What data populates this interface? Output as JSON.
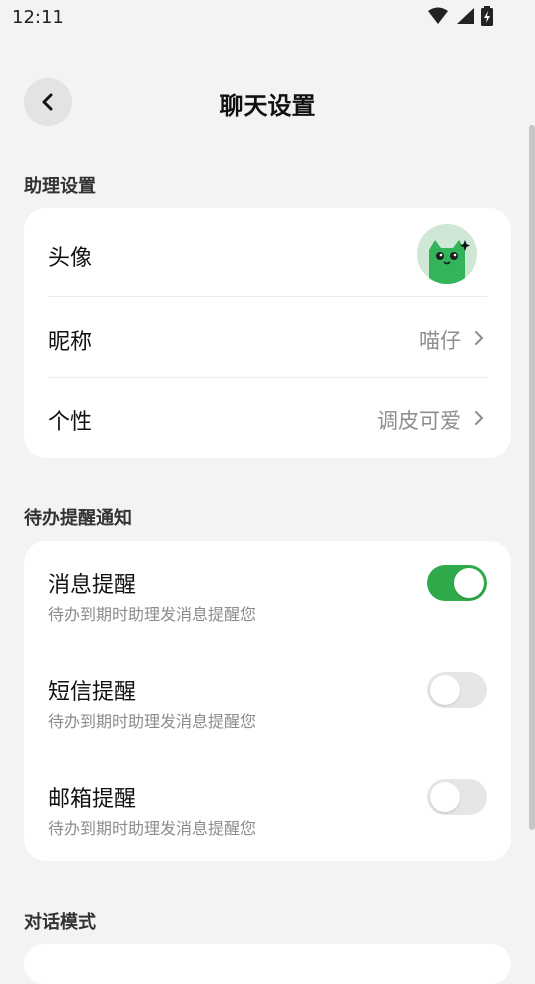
{
  "status_bar": {
    "time": "12:11"
  },
  "nav": {
    "title": "聊天设置"
  },
  "assistant_section": {
    "header": "助理设置",
    "avatar_label": "头像",
    "nickname_label": "昵称",
    "nickname_value": "喵仔",
    "personality_label": "个性",
    "personality_value": "调皮可爱"
  },
  "todo_section": {
    "header": "待办提醒通知",
    "items": [
      {
        "title": "消息提醒",
        "desc": "待办到期时助理发消息提醒您",
        "enabled": true
      },
      {
        "title": "短信提醒",
        "desc": "待办到期时助理发消息提醒您",
        "enabled": false
      },
      {
        "title": "邮箱提醒",
        "desc": "待办到期时助理发消息提醒您",
        "enabled": false
      }
    ]
  },
  "dialog_section": {
    "header": "对话模式"
  },
  "colors": {
    "accent": "#2faa4a",
    "background": "#f3f3f3",
    "card": "#ffffff",
    "secondary_text": "#8e8e8e"
  },
  "icons": [
    "wifi-icon",
    "signal-icon",
    "battery-icon",
    "back-chevron-icon",
    "chevron-right-icon",
    "cat-avatar"
  ]
}
